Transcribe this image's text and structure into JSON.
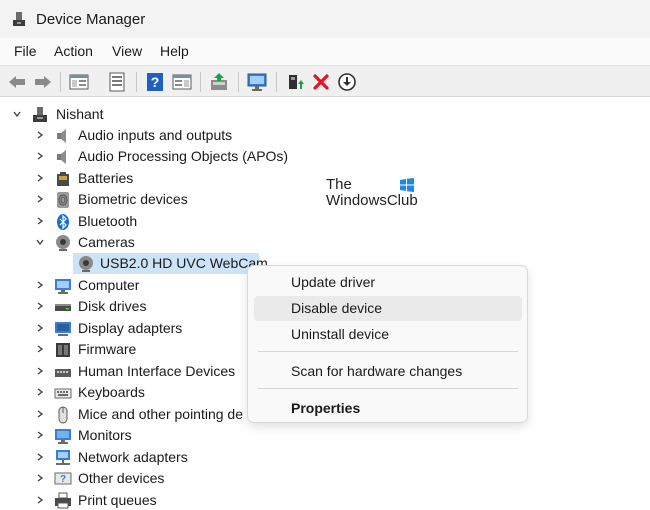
{
  "window": {
    "title": "Device Manager"
  },
  "menu": [
    "File",
    "Action",
    "View",
    "Help"
  ],
  "toolbar": {
    "buttons": [
      "back-icon",
      "forward-icon",
      "properties-pane-icon",
      "document-icon",
      "help-icon",
      "console-tree-icon",
      "update-driver-icon",
      "scan-monitor-icon",
      "enable-device-icon",
      "uninstall-x-icon",
      "disable-device-icon"
    ],
    "colors": {
      "uninstall": "#e81123",
      "help": "#1f5fbf",
      "enable": "#17a34a"
    }
  },
  "tree": {
    "root": "Nishant",
    "categories": [
      "Audio inputs and outputs",
      "Audio Processing Objects (APOs)",
      "Batteries",
      "Biometric devices",
      "Bluetooth",
      "Cameras",
      "Computer",
      "Disk drives",
      "Display adapters",
      "Firmware",
      "Human Interface Devices",
      "Keyboards",
      "Mice and other pointing de",
      "Monitors",
      "Network adapters",
      "Other devices",
      "Print queues"
    ],
    "expanded_category": "Cameras",
    "selected_device": "USB2.0 HD UVC WebCam"
  },
  "context_menu": {
    "items": [
      "Update driver",
      "Disable device",
      "Uninstall device",
      "Scan for hardware changes",
      "Properties"
    ],
    "highlighted": "Disable device"
  },
  "watermark": {
    "line1": "The",
    "line2": "WindowsClub",
    "logo_color": "#1e88e5"
  }
}
